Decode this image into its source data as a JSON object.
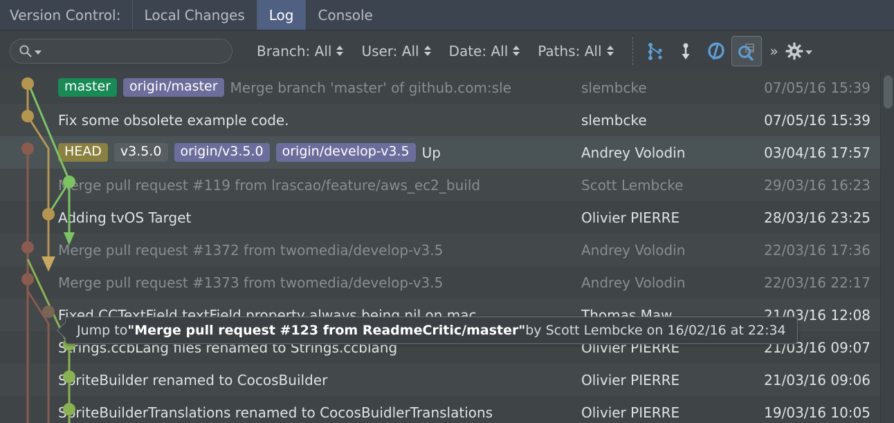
{
  "window": {
    "title": "Version Control:",
    "tabs": [
      {
        "label": "Local Changes",
        "active": false
      },
      {
        "label": "Log",
        "active": true
      },
      {
        "label": "Console",
        "active": false
      }
    ]
  },
  "toolbar": {
    "search": {
      "value": "",
      "placeholder": "",
      "icon": "search-icon",
      "dropdown_icon": "chevron-down-icon"
    },
    "filters": [
      {
        "label": "Branch: All",
        "icon": "updown-arrows-icon"
      },
      {
        "label": "User: All",
        "icon": "updown-arrows-icon"
      },
      {
        "label": "Date: All",
        "icon": "updown-arrows-icon"
      },
      {
        "label": "Paths: All",
        "icon": "updown-arrows-icon"
      }
    ],
    "actions": [
      {
        "name": "collapse-graph-icon",
        "pressed": false
      },
      {
        "name": "go-to-child-icon",
        "pressed": false
      },
      {
        "name": "refresh-icon",
        "pressed": false
      },
      {
        "name": "show-details-icon",
        "pressed": true
      }
    ],
    "overflow_label": "»",
    "settings_icon": "gear-icon",
    "settings_dropdown_icon": "chevron-down-icon"
  },
  "log": {
    "rows": [
      {
        "refs": [
          {
            "text": "master",
            "style": "green"
          },
          {
            "text": "origin/master",
            "style": "purple"
          }
        ],
        "subject": "Merge branch 'master' of github.com:sle",
        "author": "slembcke",
        "date": "07/05/16 15:39",
        "dim": true,
        "selected": false,
        "gutter": "#6b4b4b"
      },
      {
        "refs": [],
        "subject": "Fix some obsolete example code.",
        "author": "slembcke",
        "date": "07/05/16 15:39",
        "dim": false,
        "selected": false,
        "gutter": "#6b4b4b"
      },
      {
        "refs": [
          {
            "text": "HEAD",
            "style": "olive"
          },
          {
            "text": "v3.5.0",
            "style": "gray"
          },
          {
            "text": "origin/v3.5.0",
            "style": "purple"
          },
          {
            "text": "origin/develop-v3.5",
            "style": "purple"
          }
        ],
        "subject": "Up",
        "author": "Andrey Volodin",
        "date": "03/04/16 17:57",
        "dim": false,
        "selected": true,
        "gutter": "#534a32"
      },
      {
        "refs": [],
        "subject": "Merge pull request #119 from lrascao/feature/aws_ec2_build",
        "author": "Scott Lembcke",
        "date": "29/03/16 16:23",
        "dim": true,
        "selected": false,
        "gutter": "#6b4b4b"
      },
      {
        "refs": [],
        "subject": "Adding tvOS Target",
        "author": "Olivier PIERRE",
        "date": "28/03/16 23:25",
        "dim": false,
        "selected": false,
        "gutter": "#6b4b4b"
      },
      {
        "refs": [],
        "subject": "Merge pull request #1372 from twomedia/develop-v3.5",
        "author": "Andrey Volodin",
        "date": "22/03/16 17:36",
        "dim": true,
        "selected": false,
        "gutter": "#534a32"
      },
      {
        "refs": [],
        "subject": "Merge pull request #1373 from twomedia/develop-v3.5",
        "author": "Andrey Volodin",
        "date": "22/03/16 22:17",
        "dim": true,
        "selected": false,
        "gutter": "#534a32"
      },
      {
        "refs": [],
        "subject": "Fixed CCTextField textField property always being nil on mac.",
        "author": "Thomas Maw",
        "date": "21/03/16 12:08",
        "dim": false,
        "selected": false,
        "gutter": "#534a32"
      },
      {
        "refs": [],
        "subject": "Strings.ccbLang files renamed to Strings.ccblang",
        "author": "Olivier PIERRE",
        "date": "21/03/16 09:07",
        "dim": false,
        "selected": false,
        "gutter": "#534a32"
      },
      {
        "refs": [],
        "subject": "SpriteBuilder renamed to CocosBuilder",
        "author": "Olivier PIERRE",
        "date": "21/03/16 09:06",
        "dim": false,
        "selected": false,
        "gutter": "#534a32"
      },
      {
        "refs": [],
        "subject": "SpriteBuilderTranslations renamed to CocosBuidlerTranslations",
        "author": "Olivier PIERRE",
        "date": "19/03/16 10:05",
        "dim": false,
        "selected": false,
        "gutter": "#534a32"
      }
    ]
  },
  "tooltip": {
    "prefix": "Jump to ",
    "quoted": "\"Merge pull request #123 from ReadmeCritic/master\"",
    "suffix": " by Scott Lembcke on 16/02/16 at 22:34"
  },
  "colors": {
    "accent_blue": "#5c9fd6",
    "branch_green": "#7cc462",
    "branch_gold": "#b5964f",
    "branch_red": "#8a5b4e",
    "selected_row": "#4a5356",
    "tab_active": "#4f6082"
  }
}
